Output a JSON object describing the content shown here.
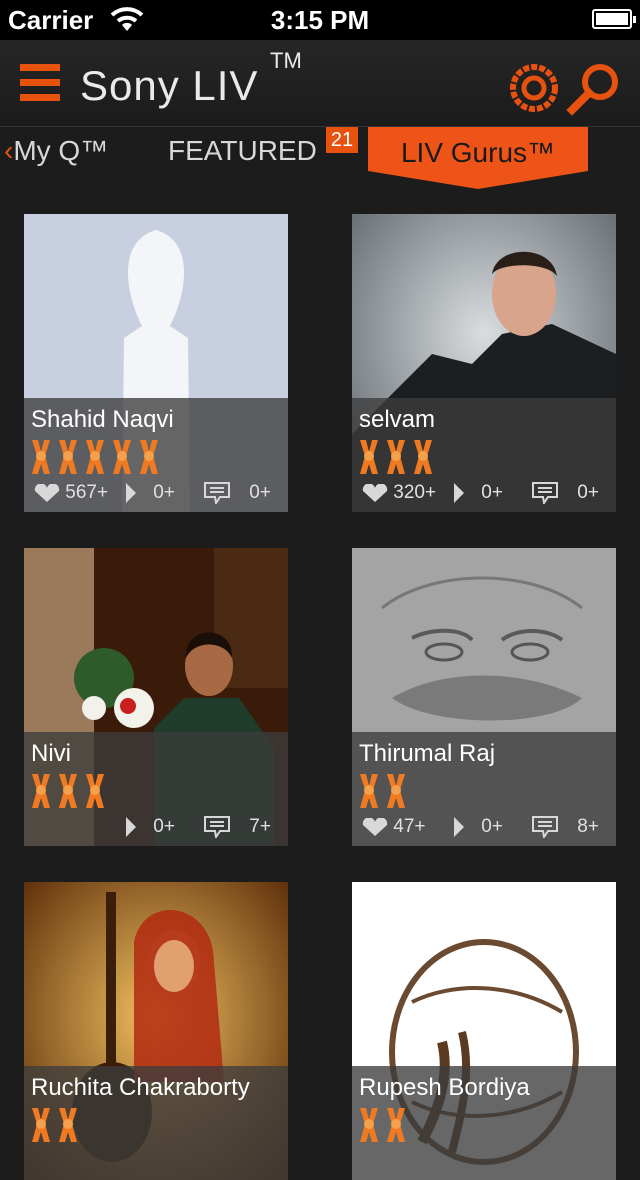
{
  "status_bar": {
    "carrier": "Carrier",
    "time": "3:15 PM"
  },
  "header": {
    "title": "Sony LIV",
    "tm": "TM"
  },
  "tabs": {
    "my_q": "My Q™",
    "featured": "FEATURED",
    "featured_badge": "21",
    "active": "LIV Gurus™"
  },
  "colors": {
    "accent": "#e8520f",
    "background": "#1c1c1c"
  },
  "gurus": [
    {
      "name": "Shahid Naqvi",
      "medals": 5,
      "likes": "567+",
      "plays": "0+",
      "comments": "0+"
    },
    {
      "name": "selvam",
      "medals": 3,
      "likes": "320+",
      "plays": "0+",
      "comments": "0+"
    },
    {
      "name": "Nivi",
      "medals": 3,
      "likes": "",
      "plays": "0+",
      "comments": "7+"
    },
    {
      "name": "Thirumal Raj",
      "medals": 2,
      "likes": "47+",
      "plays": "0+",
      "comments": "8+"
    },
    {
      "name": "Ruchita Chakraborty",
      "medals": 2
    },
    {
      "name": "Rupesh Bordiya",
      "medals": 2
    }
  ]
}
